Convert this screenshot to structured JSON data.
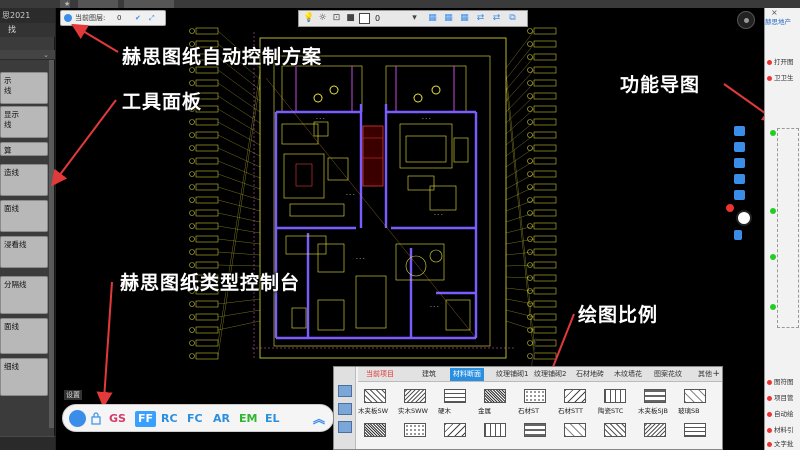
{
  "app": {
    "title_fragment": "思2021",
    "left_tab": "找",
    "tab_top": "打开"
  },
  "layer_bar": {
    "label": "当前图层:",
    "value": "0"
  },
  "toolbar": {
    "layer_value": "0"
  },
  "annotations": {
    "auto_control": "赫思图纸自动控制方案",
    "tool_panel": "工具面板",
    "type_console": "赫思图纸类型控制台",
    "scale": "绘图比例",
    "function_map": "功能导图"
  },
  "left_panel": {
    "buttons": [
      "示\n线",
      "显示\n线",
      "算",
      "造线",
      "面线",
      "浸看线",
      "分隔线",
      "面线",
      "细线"
    ]
  },
  "console": {
    "label": "设置",
    "items": [
      {
        "text": "GS",
        "color": "#d63a6a"
      },
      {
        "text": "FF",
        "color": "#ffffff"
      },
      {
        "text": "RC",
        "color": "#2b8fe0"
      },
      {
        "text": "FC",
        "color": "#2b8fe0"
      },
      {
        "text": "AR",
        "color": "#2b8fe0"
      },
      {
        "text": "EM",
        "color": "#2fb52f"
      },
      {
        "text": "EL",
        "color": "#2b8fe0"
      }
    ]
  },
  "material_panel": {
    "tabs": [
      "当前项目",
      "建筑",
      "材料断面",
      "纹理铺砌1",
      "纹理铺砌2",
      "石材地砖",
      "木纹墙花",
      "图案花纹",
      "其他"
    ],
    "active_tab": "材料断面",
    "current_tab": "当前项目",
    "swatches": [
      "木夹板SW",
      "实木SWW",
      "硬木",
      "金属",
      "石材ST",
      "石材STT",
      "陶瓷STC",
      "木夹板SJB",
      "玻璃SB"
    ]
  },
  "right_panel": {
    "header": "赫思地产",
    "rows": [
      {
        "text": "打开图",
        "dot": "red"
      },
      {
        "text": "卫卫生",
        "dot": "red"
      },
      {
        "text": "图符图",
        "dot": "red"
      },
      {
        "text": "项目管",
        "dot": "red"
      },
      {
        "text": "自动绘",
        "dot": "red"
      },
      {
        "text": "材料引",
        "dot": "red"
      },
      {
        "text": "文字批",
        "dot": "red"
      }
    ]
  },
  "colors": {
    "accent": "#2b8fe0",
    "canvas_bg": "#000000",
    "cad_yellow": "#e8e23a",
    "cad_purple": "#7a5cff"
  }
}
